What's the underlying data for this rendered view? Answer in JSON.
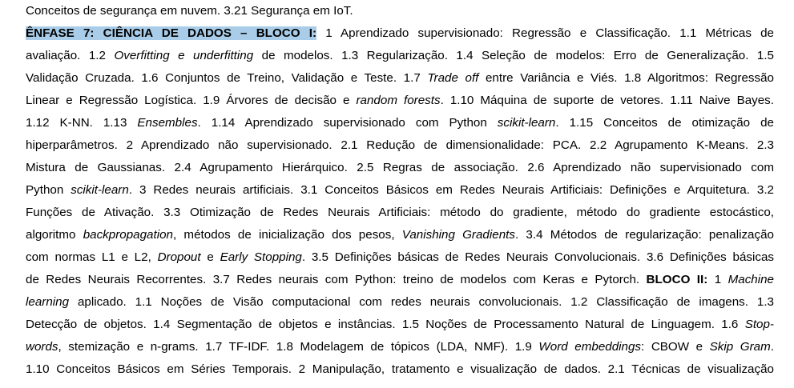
{
  "document": {
    "lines": [
      {
        "segments": [
          {
            "t": "Conceitos de segurança em nuvem. 3.21 Segurança em IoT."
          }
        ]
      },
      {
        "segments": [
          {
            "t": "ÊNFASE 7: CIÊNCIA DE DADOS – BLOCO I:",
            "style": "hl"
          },
          {
            "t": " 1 Aprendizado supervisionado: Regressão e Classificação. 1.1 Métricas de"
          }
        ]
      },
      {
        "segments": [
          {
            "t": "avaliação. 1.2 "
          },
          {
            "t": "Overfitting e underfitting",
            "style": "i"
          },
          {
            "t": " de modelos. 1.3 Regularização. 1.4 Seleção de modelos: Erro de Generalização. 1.5"
          }
        ]
      },
      {
        "segments": [
          {
            "t": "Validação Cruzada. 1.6 Conjuntos de Treino, Validação e Teste. 1.7 "
          },
          {
            "t": "Trade off",
            "style": "i"
          },
          {
            "t": " entre Variância e Viés. 1.8 Algoritmos: Regressão"
          }
        ]
      },
      {
        "segments": [
          {
            "t": "Linear e Regressão Logística. 1.9 Árvores de decisão e "
          },
          {
            "t": "random forests",
            "style": "i"
          },
          {
            "t": ". 1.10 Máquina de suporte de vetores. 1.11 Naive Bayes."
          }
        ]
      },
      {
        "segments": [
          {
            "t": "1.12 K-NN. 1.13 "
          },
          {
            "t": "Ensembles",
            "style": "i"
          },
          {
            "t": ". 1.14 Aprendizado supervisionado com Python "
          },
          {
            "t": "scikit-learn",
            "style": "i"
          },
          {
            "t": ". 1.15 Conceitos de otimização de"
          }
        ]
      },
      {
        "segments": [
          {
            "t": "hiperparâmetros. 2 Aprendizado não supervisionado. 2.1 Redução de dimensionalidade: PCA. 2.2 Agrupamento K-Means. 2.3"
          }
        ]
      },
      {
        "segments": [
          {
            "t": "Mistura de Gaussianas. 2.4 Agrupamento Hierárquico. 2.5 Regras de associação. 2.6 Aprendizado não supervisionado com"
          }
        ]
      },
      {
        "segments": [
          {
            "t": "Python "
          },
          {
            "t": "scikit-learn",
            "style": "i"
          },
          {
            "t": ". 3 Redes neurais artificiais. 3.1 Conceitos Básicos em Redes Neurais Artificiais: Definições e Arquitetura. 3.2"
          }
        ]
      },
      {
        "segments": [
          {
            "t": "Funções de Ativação. 3.3 Otimização de Redes Neurais Artificiais: método do gradiente, método do gradiente estocástico,"
          }
        ]
      },
      {
        "segments": [
          {
            "t": "algoritmo "
          },
          {
            "t": "backpropagation",
            "style": "i"
          },
          {
            "t": ", métodos de inicialização dos pesos, "
          },
          {
            "t": "Vanishing Gradients",
            "style": "i"
          },
          {
            "t": ". 3.4 Métodos de regularização: penalização"
          }
        ]
      },
      {
        "segments": [
          {
            "t": "com normas L1 e L2, "
          },
          {
            "t": "Dropout",
            "style": "i"
          },
          {
            "t": " e "
          },
          {
            "t": "Early Stopping",
            "style": "i"
          },
          {
            "t": ". 3.5 Definições básicas de Redes Neurais Convolucionais. 3.6 Definições básicas"
          }
        ]
      },
      {
        "segments": [
          {
            "t": "de Redes Neurais Recorrentes. 3.7 Redes neurais com Python: treino de modelos com Keras e Pytorch. "
          },
          {
            "t": "BLOCO II:",
            "style": "b"
          },
          {
            "t": " 1 "
          },
          {
            "t": "Machine",
            "style": "i"
          }
        ]
      },
      {
        "segments": [
          {
            "t": "learning",
            "style": "i"
          },
          {
            "t": " aplicado. 1.1 Noções de Visão computacional com redes neurais convolucionais. 1.2 Classificação de imagens. 1.3"
          }
        ]
      },
      {
        "segments": [
          {
            "t": "Detecção de objetos. 1.4 Segmentação de objetos e instâncias. 1.5 Noções de Processamento Natural de Linguagem. 1.6 "
          },
          {
            "t": "Stop-",
            "style": "i"
          }
        ]
      },
      {
        "segments": [
          {
            "t": "words",
            "style": "i"
          },
          {
            "t": ", stemização e n-grams. 1.7 TF-IDF. 1.8 Modelagem de tópicos (LDA, NMF). 1.9 "
          },
          {
            "t": "Word embeddings",
            "style": "i"
          },
          {
            "t": ": CBOW e "
          },
          {
            "t": "Skip Gram",
            "style": "i"
          },
          {
            "t": "."
          }
        ]
      },
      {
        "segments": [
          {
            "t": "1.10 Conceitos Básicos em Séries Temporais. 2 Manipulação, tratamento e visualização de dados. 2.1 Técnicas de visualização"
          }
        ]
      }
    ]
  }
}
